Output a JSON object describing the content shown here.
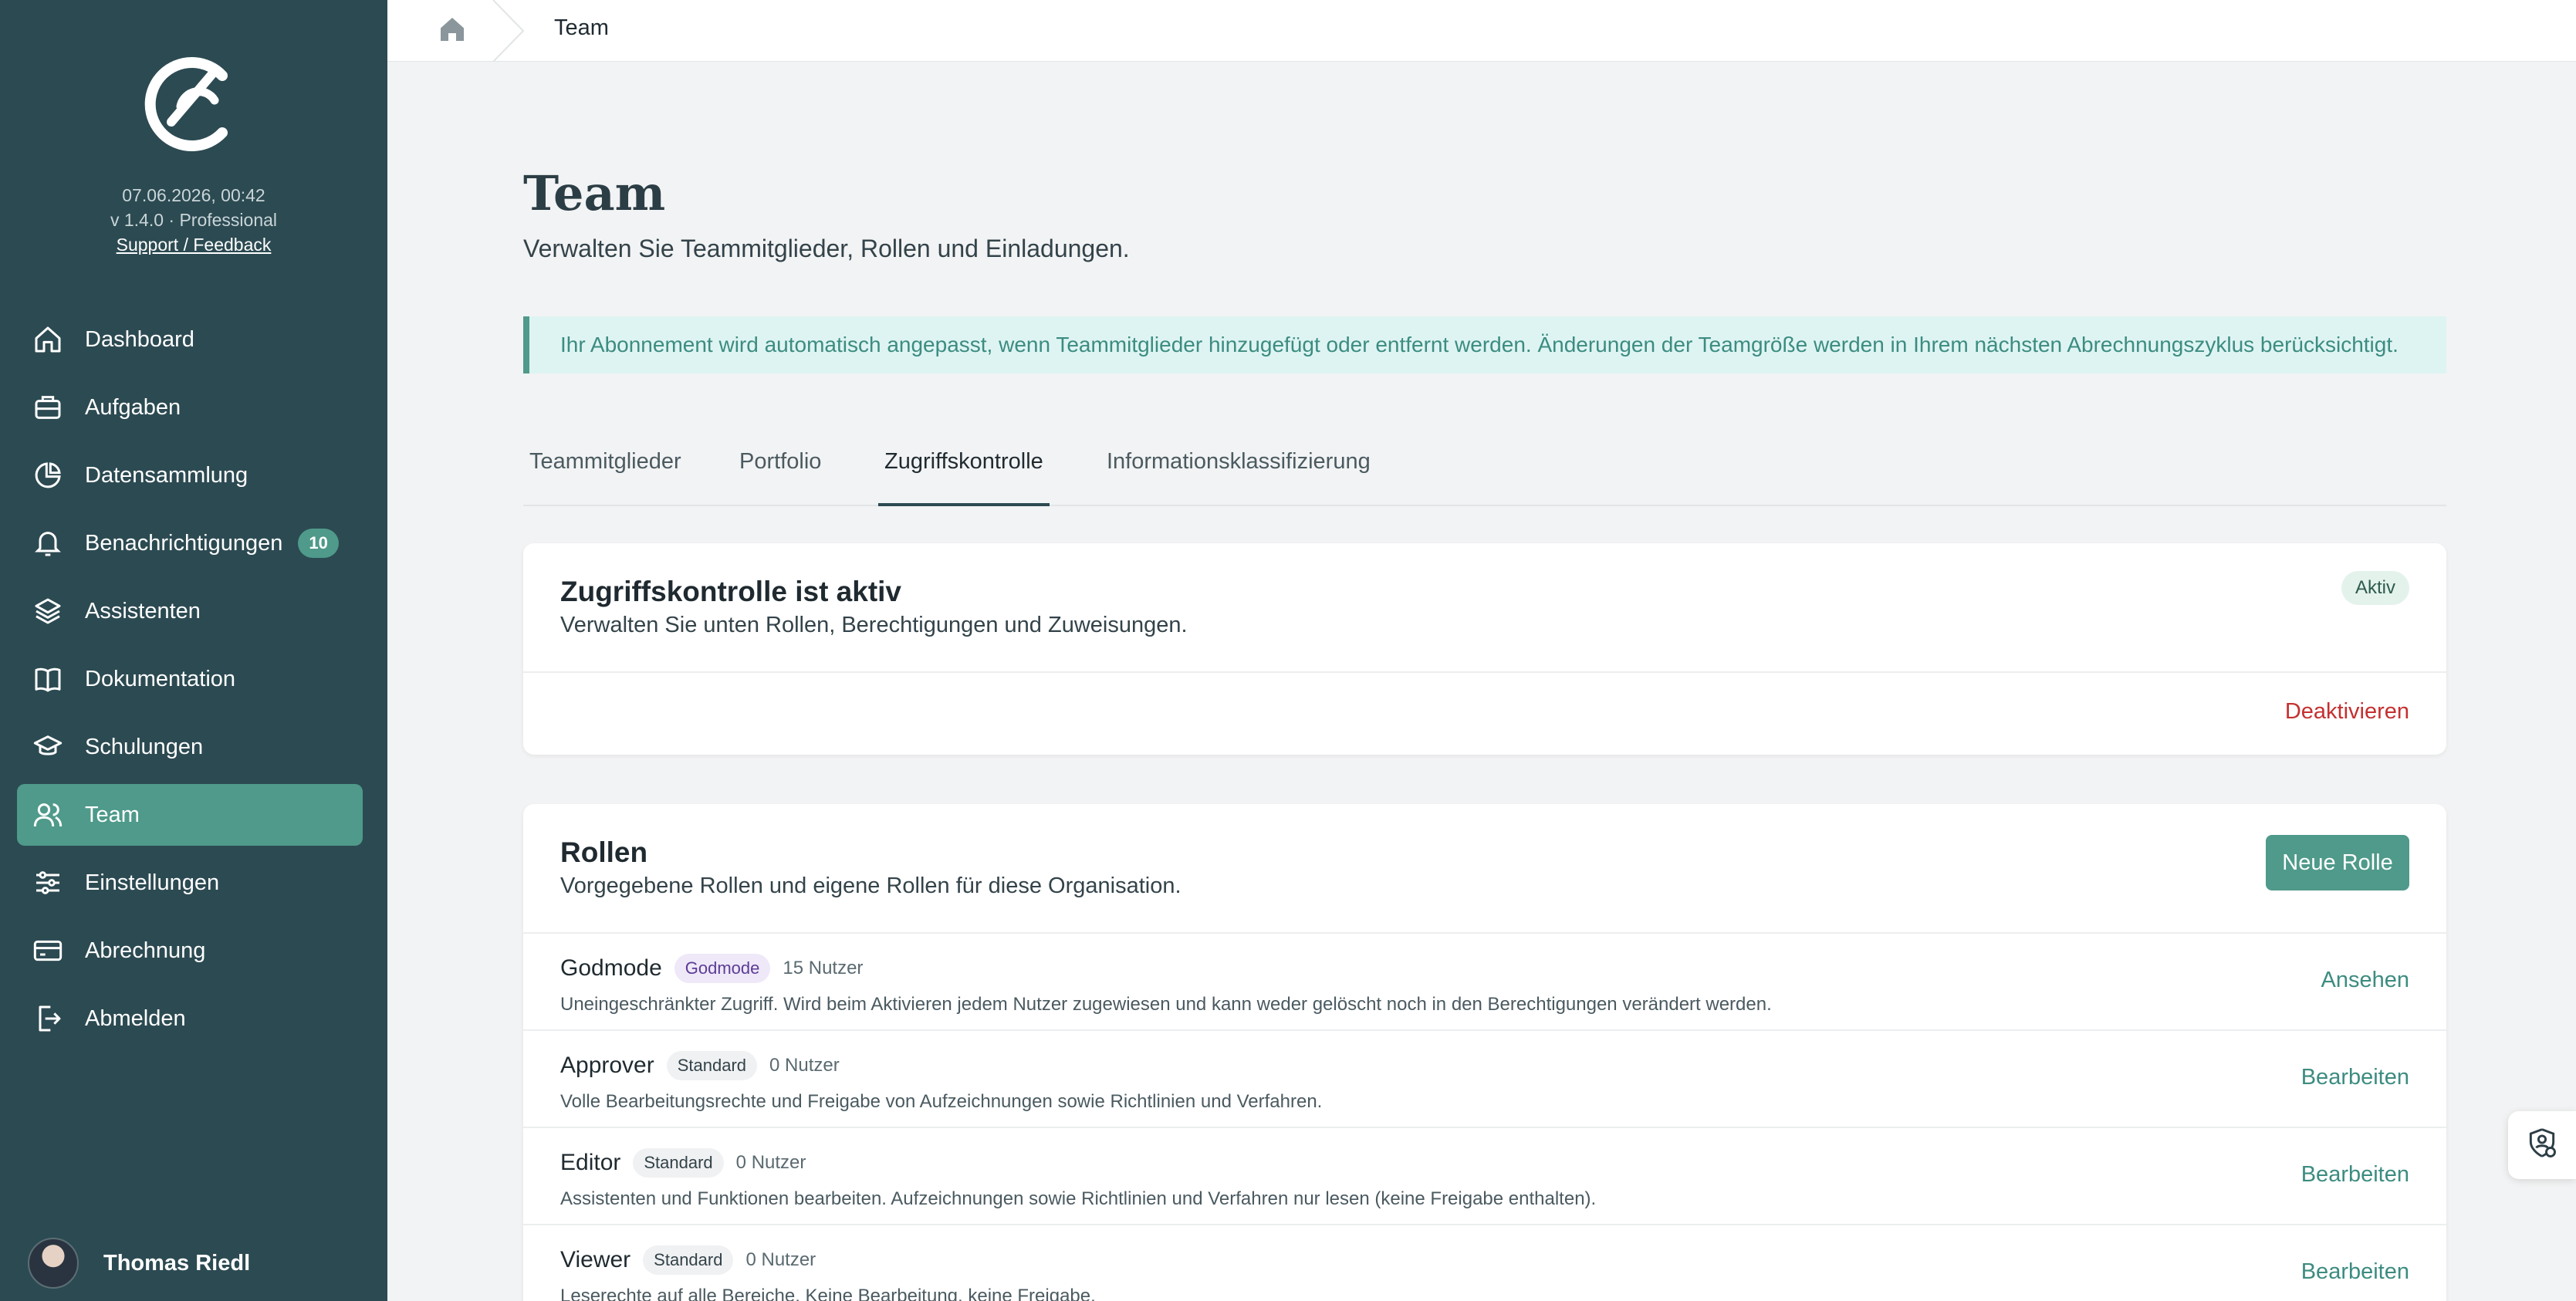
{
  "sidebar": {
    "date": "07.06.2026, 00:42",
    "version": "v 1.4.0 · Professional",
    "support": "Support / Feedback",
    "items": [
      {
        "label": "Dashboard",
        "icon": "home-icon"
      },
      {
        "label": "Aufgaben",
        "icon": "briefcase-icon"
      },
      {
        "label": "Datensammlung",
        "icon": "pie-chart-icon"
      },
      {
        "label": "Benachrichtigungen",
        "icon": "bell-icon",
        "badge": "10"
      },
      {
        "label": "Assistenten",
        "icon": "layers-icon"
      },
      {
        "label": "Dokumentation",
        "icon": "book-icon"
      },
      {
        "label": "Schulungen",
        "icon": "graduation-cap-icon"
      },
      {
        "label": "Team",
        "icon": "users-icon",
        "active": true
      },
      {
        "label": "Einstellungen",
        "icon": "sliders-icon"
      },
      {
        "label": "Abrechnung",
        "icon": "credit-card-icon"
      },
      {
        "label": "Abmelden",
        "icon": "logout-icon"
      }
    ],
    "user_name": "Thomas Riedl"
  },
  "breadcrumb": {
    "current": "Team"
  },
  "page": {
    "title": "Team",
    "subtitle": "Verwalten Sie Teammitglieder, Rollen und Einladungen.",
    "notice": "Ihr Abonnement wird automatisch angepasst, wenn Teammitglieder hinzugefügt oder entfernt werden. Änderungen der Teamgröße werden in Ihrem nächsten Abrechnungszyklus berücksichtigt."
  },
  "tabs": [
    {
      "label": "Teammitglieder"
    },
    {
      "label": "Portfolio"
    },
    {
      "label": "Zugriffskontrolle",
      "active": true
    },
    {
      "label": "Informationsklassifizierung"
    }
  ],
  "access_control": {
    "title": "Zugriffskontrolle ist aktiv",
    "description": "Verwalten Sie unten Rollen, Berechtigungen und Zuweisungen.",
    "status_badge": "Aktiv",
    "deactivate_label": "Deaktivieren"
  },
  "roles": {
    "title": "Rollen",
    "description": "Vorgegebene Rollen und eigene Rollen für diese Organisation.",
    "new_role_label": "Neue Rolle",
    "items": [
      {
        "name": "Godmode",
        "tag": "Godmode",
        "users": "15 Nutzer",
        "description": "Uneingeschränkter Zugriff. Wird beim Aktivieren jedem Nutzer zugewiesen und kann weder gelöscht noch in den Berechtigungen verändert werden.",
        "action": "Ansehen"
      },
      {
        "name": "Approver",
        "tag": "Standard",
        "users": "0 Nutzer",
        "description": "Volle Bearbeitungsrechte und Freigabe von Aufzeichnungen sowie Richtlinien und Verfahren.",
        "action": "Bearbeiten"
      },
      {
        "name": "Editor",
        "tag": "Standard",
        "users": "0 Nutzer",
        "description": "Assistenten und Funktionen bearbeiten. Aufzeichnungen sowie Richtlinien und Verfahren nur lesen (keine Freigabe enthalten).",
        "action": "Bearbeiten"
      },
      {
        "name": "Viewer",
        "tag": "Standard",
        "users": "0 Nutzer",
        "description": "Leserechte auf alle Bereiche. Keine Bearbeitung, keine Freigabe.",
        "action": "Bearbeiten"
      }
    ]
  },
  "colors": {
    "sidebar_bg": "#2c4a52",
    "accent": "#4f9a8a",
    "danger": "#c53030"
  }
}
